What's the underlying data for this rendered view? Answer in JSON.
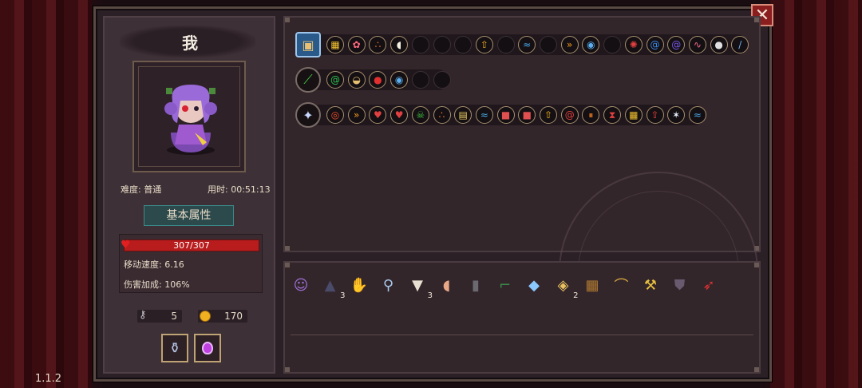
{
  "player": {
    "name": "我",
    "difficulty": "难度: 普通",
    "time": "用时: 00:51:13"
  },
  "tabs": {
    "attributes": "基本属性"
  },
  "stats": {
    "hp": "307/307",
    "move_speed": "移动速度: 6.16",
    "damage_bonus": "伤害加成: 106%"
  },
  "resources": {
    "keys": "5",
    "coins": "170"
  },
  "close_label": "✕",
  "version": "1.1.2",
  "consumables": [
    "potion-jar-icon",
    "purple-potion-icon"
  ],
  "weapon_rows": [
    {
      "weapon_icon": "treasure-chest-icon",
      "slots": [
        {
          "icon": "yellow-squares-icon",
          "c": "#f0c030"
        },
        {
          "icon": "pink-flower-icon",
          "c": "#ff6a80"
        },
        {
          "icon": "orange-triple-dots-icon",
          "c": "#ff7a30"
        },
        {
          "icon": "mouse-icon",
          "c": "#f4f0e0"
        },
        {
          "icon": "empty",
          "c": ""
        },
        {
          "icon": "empty",
          "c": ""
        },
        {
          "icon": "empty",
          "c": ""
        },
        {
          "icon": "yellow-up-arrow-icon",
          "c": "#f0b020"
        },
        {
          "icon": "empty",
          "c": ""
        },
        {
          "icon": "blue-wave-icon",
          "c": "#4aa8e8"
        },
        {
          "icon": "empty",
          "c": ""
        },
        {
          "icon": "orange-chevrons-icon",
          "c": "#f09a20"
        },
        {
          "icon": "blue-eye-icon",
          "c": "#5ab0f0"
        },
        {
          "icon": "empty",
          "c": ""
        },
        {
          "icon": "red-gear-icon",
          "c": "#e04040"
        },
        {
          "icon": "blue-spiral-square-icon",
          "c": "#3a8ae8"
        },
        {
          "icon": "purple-vortex-icon",
          "c": "#7a5ae8"
        },
        {
          "icon": "pink-pulse-icon",
          "c": "#f06a8a"
        },
        {
          "icon": "white-orb-icon",
          "c": "#e0e0e0"
        },
        {
          "icon": "blue-sword-icon",
          "c": "#6ab0f0"
        }
      ]
    },
    {
      "weapon_icon": "green-blade-icon",
      "slots": [
        {
          "icon": "green-swirl-icon",
          "c": "#30c050"
        },
        {
          "icon": "bread-icon",
          "c": "#e8c070"
        },
        {
          "icon": "red-berries-icon",
          "c": "#e03030"
        },
        {
          "icon": "blue-eye-icon",
          "c": "#5ab0f0"
        },
        {
          "icon": "empty",
          "c": ""
        },
        {
          "icon": "empty",
          "c": ""
        }
      ]
    },
    {
      "weapon_icon": "magic-staff-icon",
      "slots": [
        {
          "icon": "red-target-icon",
          "c": "#f05030"
        },
        {
          "icon": "orange-chevrons-icon",
          "c": "#f09a20"
        },
        {
          "icon": "red-heart-icon",
          "c": "#e04040"
        },
        {
          "icon": "red-heart-icon",
          "c": "#e04040"
        },
        {
          "icon": "green-skull-icon",
          "c": "#40c040"
        },
        {
          "icon": "orange-triple-dots-icon",
          "c": "#ff7a30"
        },
        {
          "icon": "yellow-book-icon",
          "c": "#f0d060"
        },
        {
          "icon": "blue-wave-icon",
          "c": "#4aa8e8"
        },
        {
          "icon": "red-box-icon",
          "c": "#e05050"
        },
        {
          "icon": "red-box-icon",
          "c": "#e05050"
        },
        {
          "icon": "yellow-up-arrow-icon",
          "c": "#f0b020"
        },
        {
          "icon": "red-swirl-icon",
          "c": "#e04040"
        },
        {
          "icon": "orange-pause-icon",
          "c": "#f08020"
        },
        {
          "icon": "red-hourglass-icon",
          "c": "#e04040"
        },
        {
          "icon": "yellow-squares-icon",
          "c": "#f0c030"
        },
        {
          "icon": "red-arrow-icon",
          "c": "#e04040"
        },
        {
          "icon": "white-star-icon",
          "c": "#e8f0ff"
        },
        {
          "icon": "blue-wave-icon",
          "c": "#4aa8e8"
        }
      ]
    }
  ],
  "items": [
    {
      "icon": "portrait-icon",
      "count": ""
    },
    {
      "icon": "dark-cloak-icon",
      "count": "3"
    },
    {
      "icon": "gauntlet-icon",
      "count": ""
    },
    {
      "icon": "magnifier-icon",
      "count": ""
    },
    {
      "icon": "fangs-icon",
      "count": "3"
    },
    {
      "icon": "egg-icon",
      "count": ""
    },
    {
      "icon": "tombstone-icon",
      "count": ""
    },
    {
      "icon": "green-boot-icon",
      "count": ""
    },
    {
      "icon": "blue-crystal-icon",
      "count": ""
    },
    {
      "icon": "gem-ring-icon",
      "count": "2"
    },
    {
      "icon": "wooden-crate-icon",
      "count": ""
    },
    {
      "icon": "bow-icon",
      "count": ""
    },
    {
      "icon": "pickaxe-icon",
      "count": ""
    },
    {
      "icon": "dark-armor-icon",
      "count": ""
    },
    {
      "icon": "red-horn-icon",
      "count": ""
    }
  ]
}
